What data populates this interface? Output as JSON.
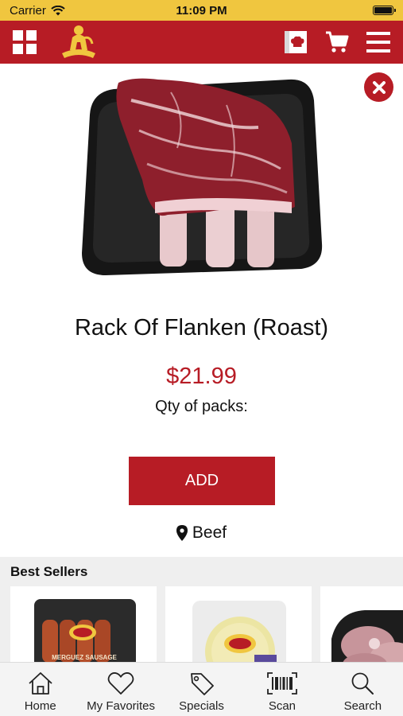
{
  "status_bar": {
    "carrier": "Carrier",
    "time": "11:09 PM"
  },
  "nav": {
    "icons": [
      "grid-menu-icon",
      "store-logo",
      "chef-card-icon",
      "cart-icon",
      "hamburger-menu-icon"
    ],
    "accent_color": "#b71c25"
  },
  "product": {
    "image": "rack-of-flanken-image",
    "title": "Rack Of Flanken (Roast)",
    "price": "$21.99",
    "qty_label": "Qty of packs:",
    "add_label": "ADD",
    "category": "Beef"
  },
  "best_sellers": {
    "title": "Best Sellers",
    "items": [
      {
        "image": "merguez-sausage-package",
        "package_text": "MERGUEZ SAUSAGE"
      },
      {
        "image": "cheese-package"
      },
      {
        "image": "meat-tray-package"
      }
    ]
  },
  "tabs": [
    {
      "label": "Home",
      "icon": "home-icon"
    },
    {
      "label": "My Favorites",
      "icon": "heart-icon"
    },
    {
      "label": "Specials",
      "icon": "tag-icon"
    },
    {
      "label": "Scan",
      "icon": "barcode-icon"
    },
    {
      "label": "Search",
      "icon": "search-icon"
    }
  ]
}
